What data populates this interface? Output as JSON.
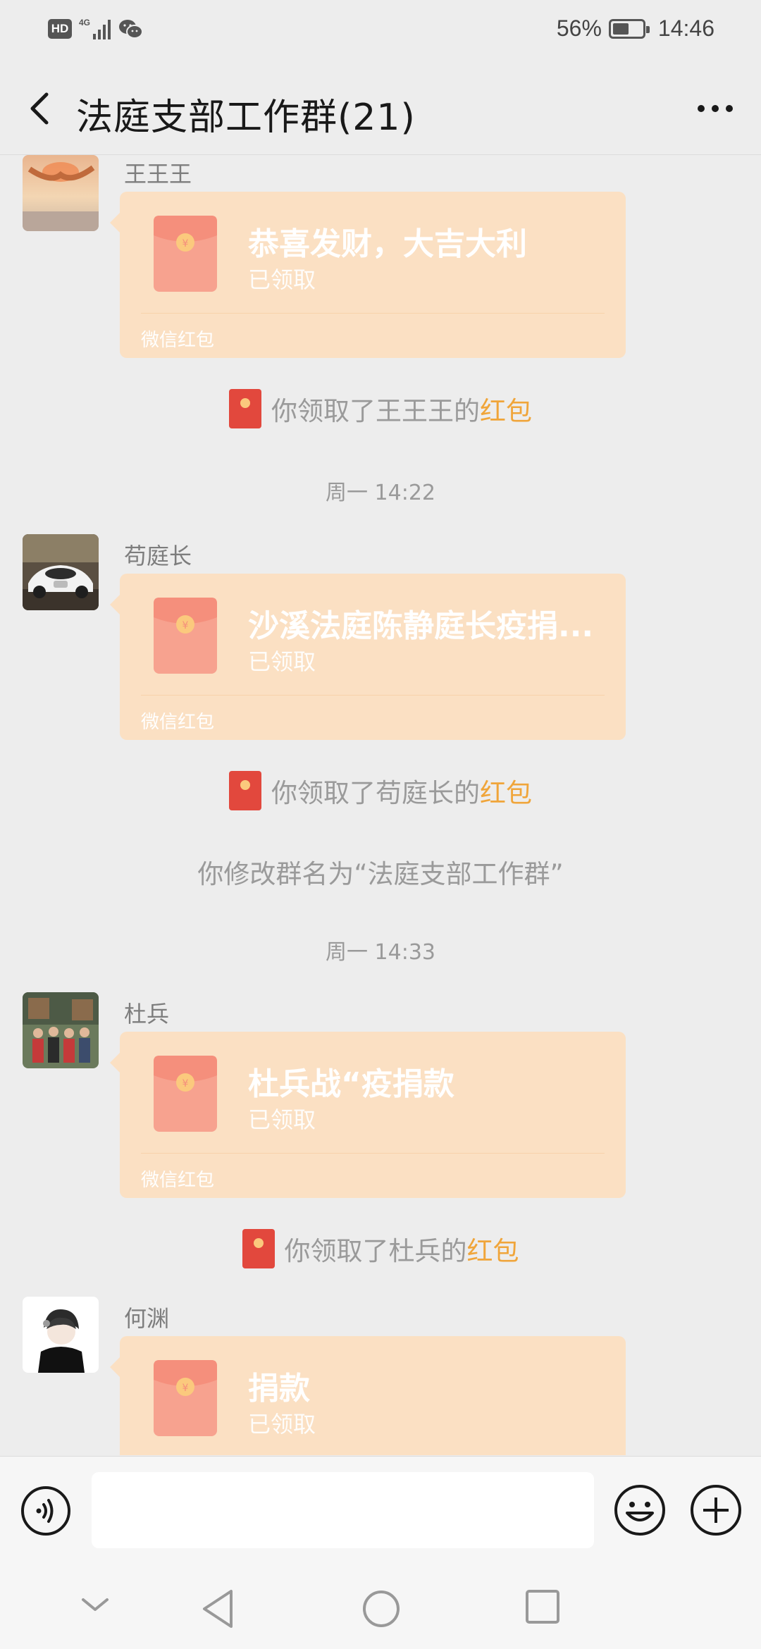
{
  "status_bar": {
    "left_icons": [
      "hd-badge",
      "4g-signal-icon",
      "wechat-icon"
    ],
    "hd_label": "HD",
    "battery_text": "56%",
    "battery_level": 0.56,
    "time": "14:46"
  },
  "nav": {
    "title": "法庭支部工作群(21)",
    "back_icon": "back-arrow-icon",
    "more_icon": "more-icon"
  },
  "messages": [
    {
      "sender": "王王王",
      "avatar": "sunset-hands-photo",
      "packet": {
        "title": "恭喜发财，大吉大利",
        "status": "已领取",
        "label": "微信红包"
      }
    },
    {
      "system": {
        "prefix": "你领取了王王王的",
        "link": "红包"
      }
    },
    {
      "timestamp": "周一 14:22"
    },
    {
      "sender": "苟庭长",
      "avatar": "white-car-photo",
      "packet": {
        "title": "沙溪法庭陈静庭长疫捐...",
        "status": "已领取",
        "label": "微信红包"
      }
    },
    {
      "system": {
        "prefix": "你领取了苟庭长的",
        "link": "红包"
      }
    },
    {
      "notice": "你修改群名为“法庭支部工作群”"
    },
    {
      "timestamp": "周一 14:33"
    },
    {
      "sender": "杜兵",
      "avatar": "group-photo",
      "packet": {
        "title": "杜兵战“疫捐款",
        "status": "已领取",
        "label": "微信红包"
      }
    },
    {
      "system": {
        "prefix": "你领取了杜兵的",
        "link": "红包"
      }
    },
    {
      "sender": "何渊",
      "avatar": "cartoon-boy-avatar",
      "packet": {
        "title": "捐款",
        "status": "已领取",
        "label": ""
      }
    }
  ],
  "input_bar": {
    "voice_icon": "voice-icon",
    "emoji_icon": "emoji-icon",
    "plus_icon": "plus-icon",
    "input_value": ""
  },
  "android_nav": [
    "chevron-down-icon",
    "back-triangle-icon",
    "home-circle-icon",
    "recents-square-icon"
  ],
  "colors": {
    "background": "#ededed",
    "packet_bg": "#fbe0c3",
    "packet_envelope": "#f7a28f",
    "highlight": "#f0a53a",
    "system_text": "#9a9a9a"
  }
}
